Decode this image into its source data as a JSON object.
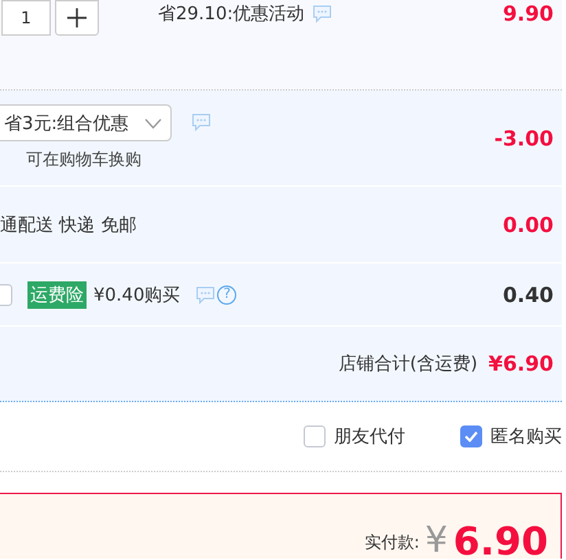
{
  "quantity": {
    "value": "1"
  },
  "promotion": {
    "text": "省29.10:优惠活动",
    "price": "9.90"
  },
  "combo": {
    "selection": "省3元:组合优惠",
    "note": "可在购物车换购",
    "price": "-3.00"
  },
  "shipping": {
    "text": "通配送 快递 免邮",
    "price": "0.00"
  },
  "insurance": {
    "checked": false,
    "tag": "运费险",
    "text": "¥0.40购买",
    "help": "?",
    "price": "0.40"
  },
  "store_total": {
    "label": "店铺合计(含运费)",
    "amount": "¥6.90"
  },
  "options": [
    {
      "label": "朋友代付",
      "checked": false
    },
    {
      "label": "匿名购买",
      "checked": true
    }
  ],
  "payment": {
    "label": "实付款:",
    "currency": "¥",
    "amount": "6.90"
  }
}
